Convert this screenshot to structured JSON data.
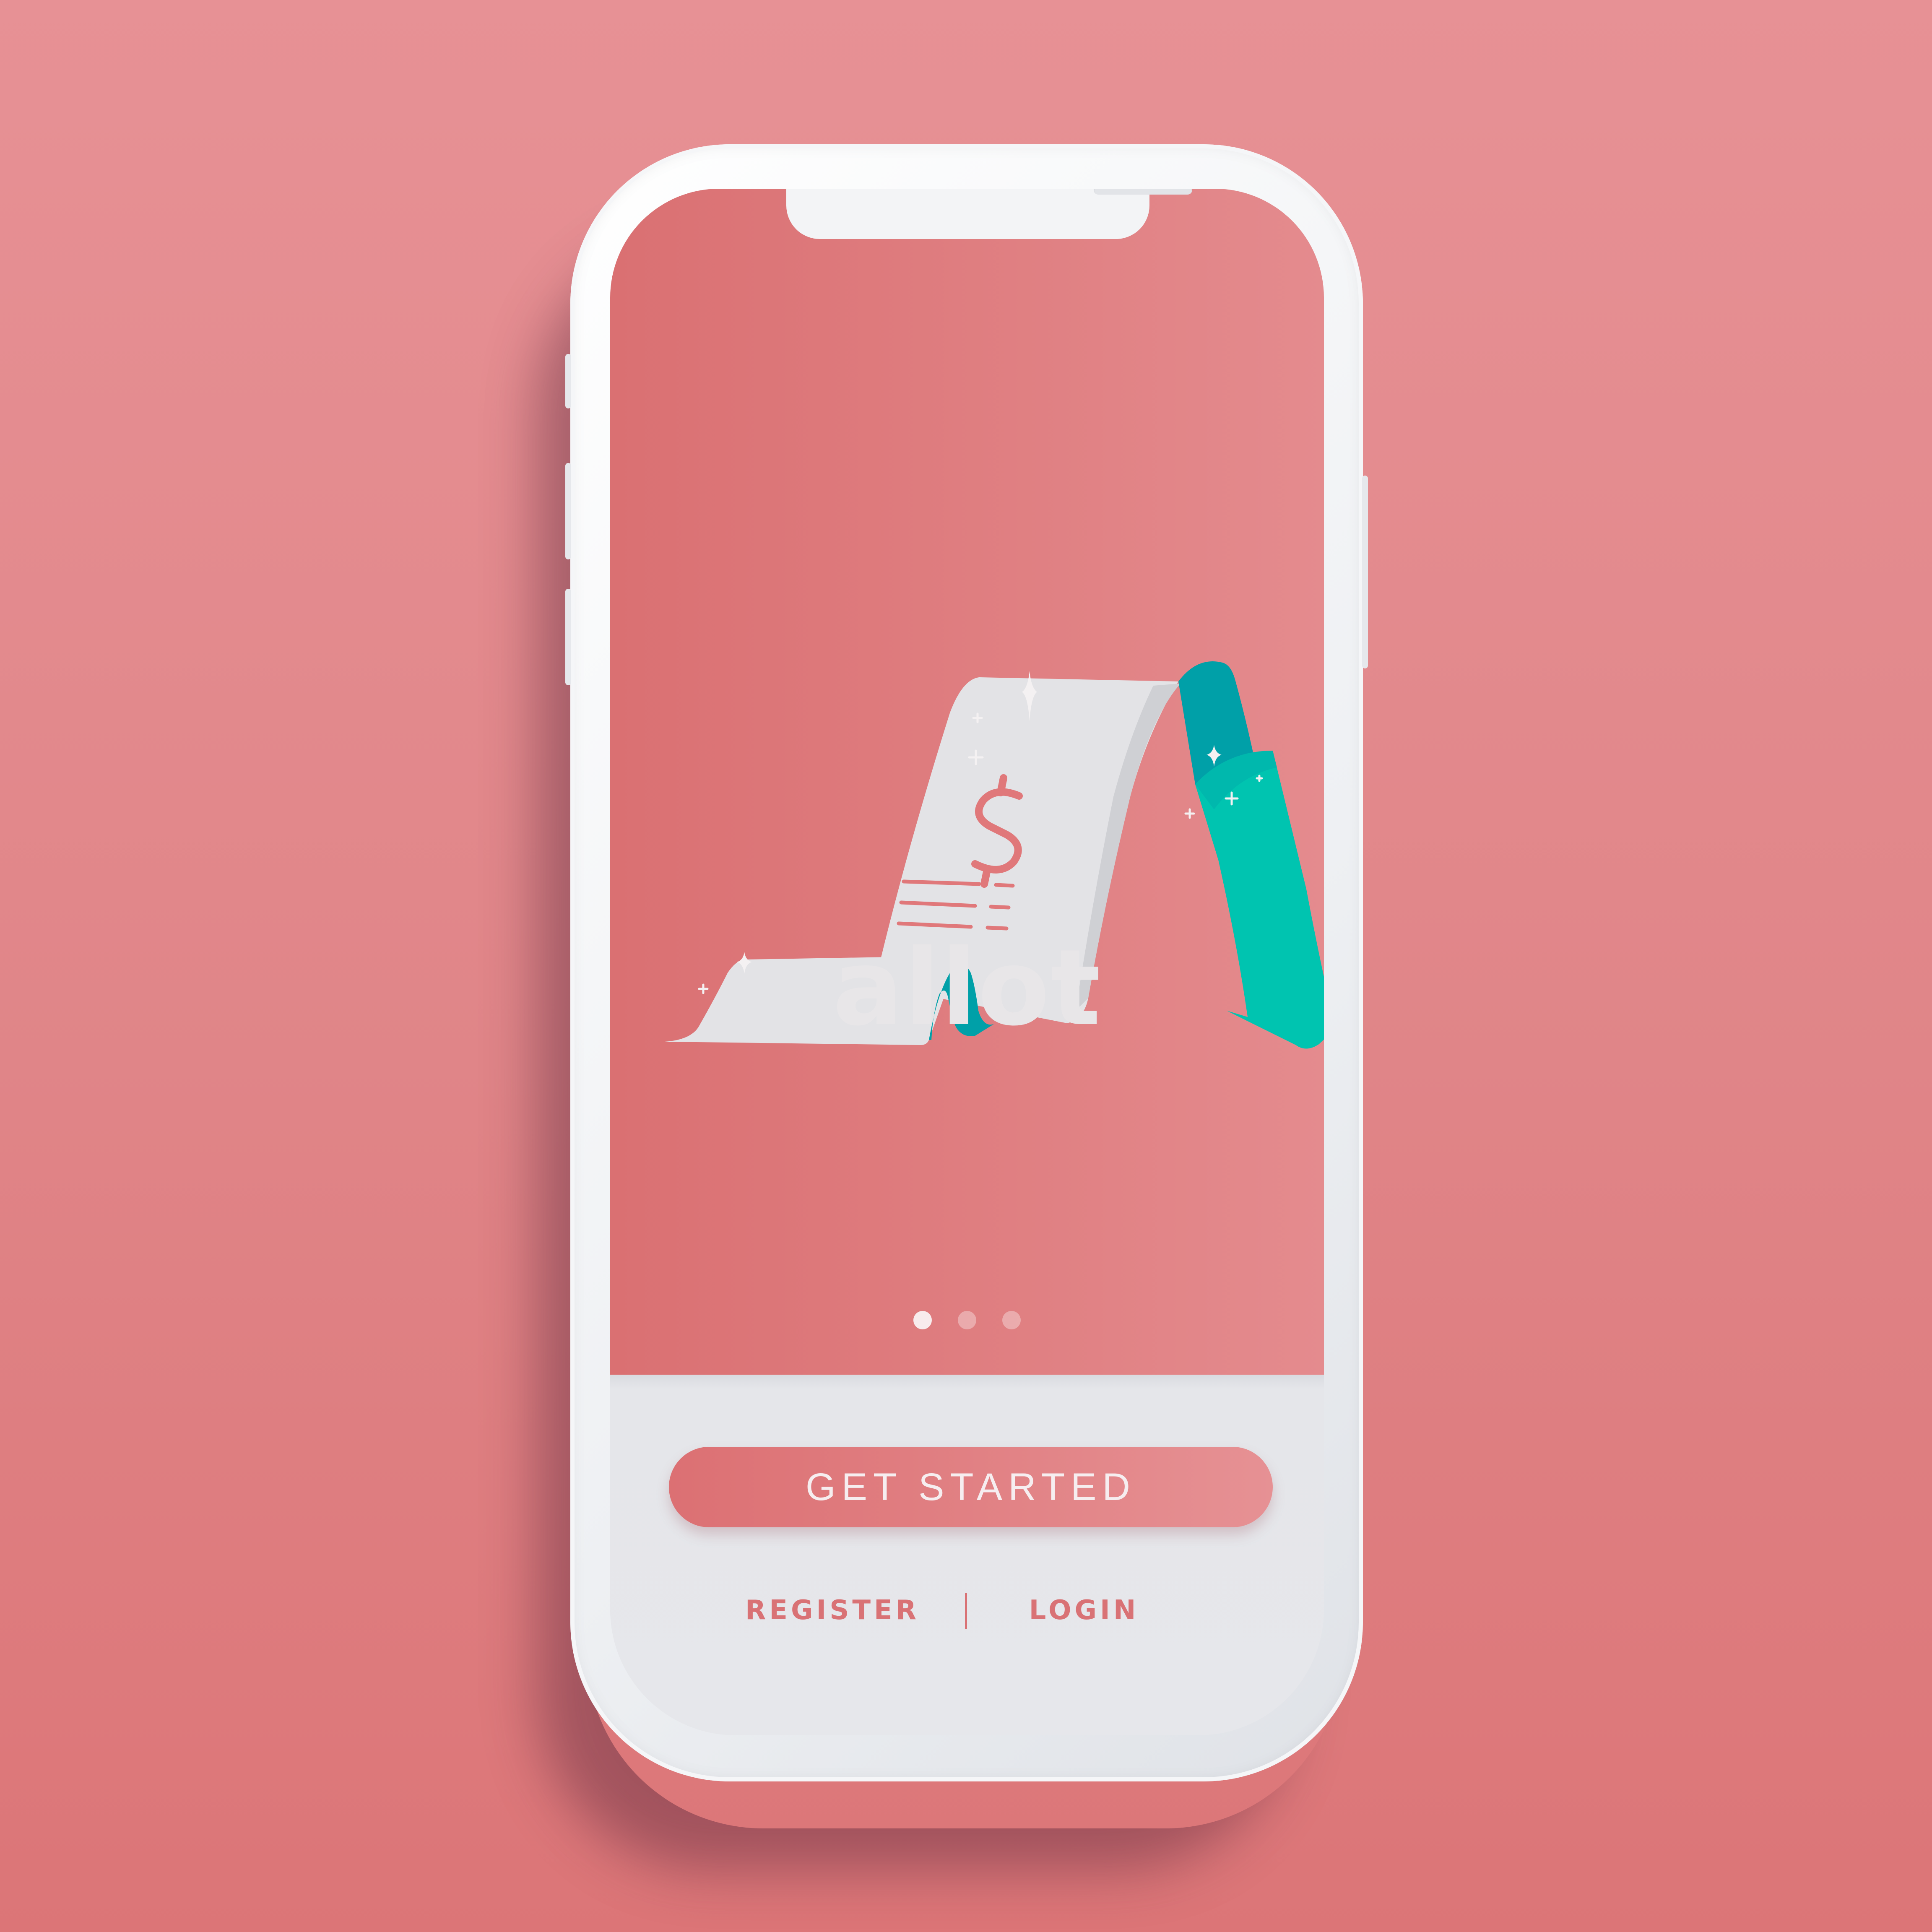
{
  "app": {
    "name": "allot"
  },
  "onboarding": {
    "page_count": 3,
    "current_page": 1
  },
  "actions": {
    "get_started_label": "GET STARTED",
    "register_label": "REGISTER",
    "login_label": "LOGIN"
  },
  "illustration": {
    "icons": [
      "receipt-icon",
      "dollar-sign-icon",
      "down-arrow-icon",
      "sparkle-icon"
    ]
  },
  "colors": {
    "background": "#e08588",
    "hero_start": "#da7072",
    "hero_end": "#e48b8e",
    "accent_teal": "#00c4b0",
    "accent_teal_dark": "#00a0a8",
    "receipt_paper": "#e2e2e5",
    "link_text": "#d97275",
    "bottom_panel": "#e6e7eb"
  }
}
